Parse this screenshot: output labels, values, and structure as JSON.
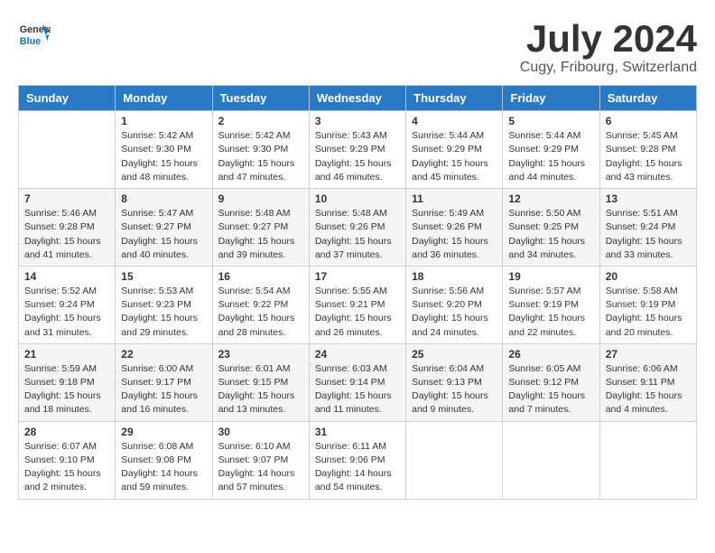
{
  "header": {
    "logo_text1": "General",
    "logo_text2": "Blue",
    "title": "July 2024",
    "location": "Cugy, Fribourg, Switzerland"
  },
  "days": [
    "Sunday",
    "Monday",
    "Tuesday",
    "Wednesday",
    "Thursday",
    "Friday",
    "Saturday"
  ],
  "weeks": [
    [
      {
        "date": "",
        "info": ""
      },
      {
        "date": "1",
        "info": "Sunrise: 5:42 AM\nSunset: 9:30 PM\nDaylight: 15 hours\nand 48 minutes."
      },
      {
        "date": "2",
        "info": "Sunrise: 5:42 AM\nSunset: 9:30 PM\nDaylight: 15 hours\nand 47 minutes."
      },
      {
        "date": "3",
        "info": "Sunrise: 5:43 AM\nSunset: 9:29 PM\nDaylight: 15 hours\nand 46 minutes."
      },
      {
        "date": "4",
        "info": "Sunrise: 5:44 AM\nSunset: 9:29 PM\nDaylight: 15 hours\nand 45 minutes."
      },
      {
        "date": "5",
        "info": "Sunrise: 5:44 AM\nSunset: 9:29 PM\nDaylight: 15 hours\nand 44 minutes."
      },
      {
        "date": "6",
        "info": "Sunrise: 5:45 AM\nSunset: 9:28 PM\nDaylight: 15 hours\nand 43 minutes."
      }
    ],
    [
      {
        "date": "7",
        "info": "Sunrise: 5:46 AM\nSunset: 9:28 PM\nDaylight: 15 hours\nand 41 minutes."
      },
      {
        "date": "8",
        "info": "Sunrise: 5:47 AM\nSunset: 9:27 PM\nDaylight: 15 hours\nand 40 minutes."
      },
      {
        "date": "9",
        "info": "Sunrise: 5:48 AM\nSunset: 9:27 PM\nDaylight: 15 hours\nand 39 minutes."
      },
      {
        "date": "10",
        "info": "Sunrise: 5:48 AM\nSunset: 9:26 PM\nDaylight: 15 hours\nand 37 minutes."
      },
      {
        "date": "11",
        "info": "Sunrise: 5:49 AM\nSunset: 9:26 PM\nDaylight: 15 hours\nand 36 minutes."
      },
      {
        "date": "12",
        "info": "Sunrise: 5:50 AM\nSunset: 9:25 PM\nDaylight: 15 hours\nand 34 minutes."
      },
      {
        "date": "13",
        "info": "Sunrise: 5:51 AM\nSunset: 9:24 PM\nDaylight: 15 hours\nand 33 minutes."
      }
    ],
    [
      {
        "date": "14",
        "info": "Sunrise: 5:52 AM\nSunset: 9:24 PM\nDaylight: 15 hours\nand 31 minutes."
      },
      {
        "date": "15",
        "info": "Sunrise: 5:53 AM\nSunset: 9:23 PM\nDaylight: 15 hours\nand 29 minutes."
      },
      {
        "date": "16",
        "info": "Sunrise: 5:54 AM\nSunset: 9:22 PM\nDaylight: 15 hours\nand 28 minutes."
      },
      {
        "date": "17",
        "info": "Sunrise: 5:55 AM\nSunset: 9:21 PM\nDaylight: 15 hours\nand 26 minutes."
      },
      {
        "date": "18",
        "info": "Sunrise: 5:56 AM\nSunset: 9:20 PM\nDaylight: 15 hours\nand 24 minutes."
      },
      {
        "date": "19",
        "info": "Sunrise: 5:57 AM\nSunset: 9:19 PM\nDaylight: 15 hours\nand 22 minutes."
      },
      {
        "date": "20",
        "info": "Sunrise: 5:58 AM\nSunset: 9:19 PM\nDaylight: 15 hours\nand 20 minutes."
      }
    ],
    [
      {
        "date": "21",
        "info": "Sunrise: 5:59 AM\nSunset: 9:18 PM\nDaylight: 15 hours\nand 18 minutes."
      },
      {
        "date": "22",
        "info": "Sunrise: 6:00 AM\nSunset: 9:17 PM\nDaylight: 15 hours\nand 16 minutes."
      },
      {
        "date": "23",
        "info": "Sunrise: 6:01 AM\nSunset: 9:15 PM\nDaylight: 15 hours\nand 13 minutes."
      },
      {
        "date": "24",
        "info": "Sunrise: 6:03 AM\nSunset: 9:14 PM\nDaylight: 15 hours\nand 11 minutes."
      },
      {
        "date": "25",
        "info": "Sunrise: 6:04 AM\nSunset: 9:13 PM\nDaylight: 15 hours\nand 9 minutes."
      },
      {
        "date": "26",
        "info": "Sunrise: 6:05 AM\nSunset: 9:12 PM\nDaylight: 15 hours\nand 7 minutes."
      },
      {
        "date": "27",
        "info": "Sunrise: 6:06 AM\nSunset: 9:11 PM\nDaylight: 15 hours\nand 4 minutes."
      }
    ],
    [
      {
        "date": "28",
        "info": "Sunrise: 6:07 AM\nSunset: 9:10 PM\nDaylight: 15 hours\nand 2 minutes."
      },
      {
        "date": "29",
        "info": "Sunrise: 6:08 AM\nSunset: 9:08 PM\nDaylight: 14 hours\nand 59 minutes."
      },
      {
        "date": "30",
        "info": "Sunrise: 6:10 AM\nSunset: 9:07 PM\nDaylight: 14 hours\nand 57 minutes."
      },
      {
        "date": "31",
        "info": "Sunrise: 6:11 AM\nSunset: 9:06 PM\nDaylight: 14 hours\nand 54 minutes."
      },
      {
        "date": "",
        "info": ""
      },
      {
        "date": "",
        "info": ""
      },
      {
        "date": "",
        "info": ""
      }
    ]
  ]
}
